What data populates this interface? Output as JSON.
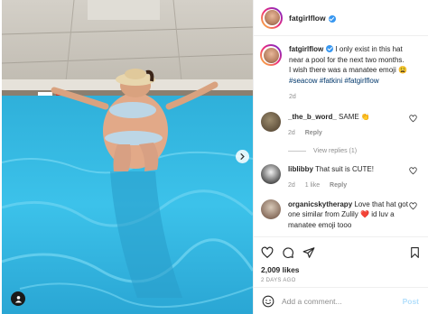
{
  "post": {
    "username": "fatgirlflow",
    "verified": true
  },
  "caption": {
    "username": "fatgirlflow",
    "text": "I only exist in this hat near a pool for the next two months. I wish there was a manatee emoji 😩",
    "hashtags": "#seacow #fatkini #fatgirlflow",
    "time": "2d"
  },
  "comments": [
    {
      "username": "_the_b_word_",
      "text": "SAME 👏",
      "time": "2d",
      "reply": "Reply",
      "likes": ""
    },
    {
      "username": "liblibby",
      "text": "That suit is CUTE!",
      "time": "2d",
      "reply": "Reply",
      "likes": "1 like"
    },
    {
      "username": "organicskytherapy",
      "text": "Love that hat got one similar from Zulily ❤️ id luv a manatee emoji tooo",
      "time": "",
      "reply": "",
      "likes": ""
    }
  ],
  "view_replies": "View replies (1)",
  "stats": {
    "likes": "2,009 likes",
    "date": "2 DAYS AGO"
  },
  "add_comment": {
    "placeholder": "Add a comment...",
    "post_label": "Post"
  },
  "icons": [
    "heart-icon",
    "comment-icon",
    "share-icon",
    "bookmark-icon",
    "emoji-icon",
    "chevron-right-icon",
    "user-tag-icon",
    "verified-icon"
  ]
}
